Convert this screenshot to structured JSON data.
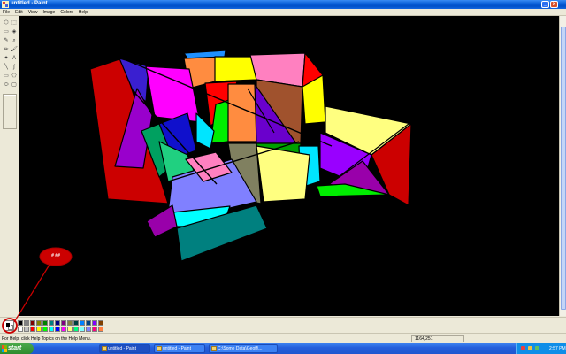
{
  "window": {
    "title": "untitled - Paint",
    "minimize_glyph": "_",
    "maximize_glyph": "□",
    "close_glyph": "x"
  },
  "menu": {
    "items": [
      "File",
      "Edit",
      "View",
      "Image",
      "Colors",
      "Help"
    ]
  },
  "toolbox": {
    "tools": [
      {
        "icon": "free-select-icon",
        "glyph": "⬡"
      },
      {
        "icon": "rect-select-icon",
        "glyph": "⬚"
      },
      {
        "icon": "eraser-icon",
        "glyph": "▭"
      },
      {
        "icon": "fill-icon",
        "glyph": "◈"
      },
      {
        "icon": "pick-color-icon",
        "glyph": "✎"
      },
      {
        "icon": "magnifier-icon",
        "glyph": "⌕"
      },
      {
        "icon": "pencil-icon",
        "glyph": "✏"
      },
      {
        "icon": "brush-icon",
        "glyph": "🖌"
      },
      {
        "icon": "airbrush-icon",
        "glyph": "✦"
      },
      {
        "icon": "text-icon",
        "glyph": "A"
      },
      {
        "icon": "line-icon",
        "glyph": "╲"
      },
      {
        "icon": "curve-icon",
        "glyph": "∫"
      },
      {
        "icon": "rectangle-icon",
        "glyph": "▭"
      },
      {
        "icon": "polygon-icon",
        "glyph": "⬠"
      },
      {
        "icon": "ellipse-icon",
        "glyph": "⬭"
      },
      {
        "icon": "rounded-rect-icon",
        "glyph": "▢"
      }
    ]
  },
  "palette": {
    "top_row": [
      "#000000",
      "#808080",
      "#800000",
      "#808000",
      "#008000",
      "#008080",
      "#000080",
      "#800080",
      "#808040",
      "#004040",
      "#0080ff",
      "#004080",
      "#8000ff",
      "#804000"
    ],
    "bottom_row": [
      "#ffffff",
      "#c0c0c0",
      "#ff0000",
      "#ffff00",
      "#00ff00",
      "#00ffff",
      "#0000ff",
      "#ff00ff",
      "#ffff80",
      "#00ff80",
      "#80ffff",
      "#8080ff",
      "#ff0080",
      "#ff8040"
    ]
  },
  "status": {
    "help_text": "For Help, click Help Topics on the Help Menu.",
    "coordinates": "1164,251"
  },
  "taskbar": {
    "start_label": "start",
    "buttons": [
      "untitled - Paint",
      "untitled - Paint",
      "C:\\Some Data\\Geoff\\..."
    ],
    "clock": "2:57 PM"
  },
  "annotation": {
    "label": "# ##",
    "color": "#cc0000"
  }
}
